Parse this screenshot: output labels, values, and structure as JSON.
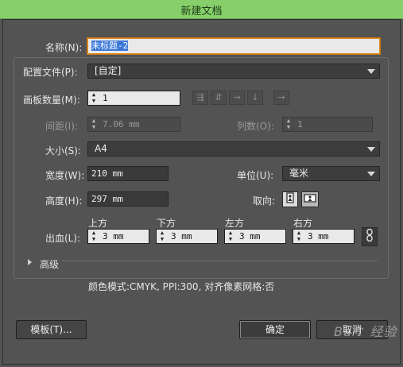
{
  "window": {
    "title": "新建文档"
  },
  "name": {
    "label": "名称(N):",
    "value": "未标题-2"
  },
  "profile": {
    "label": "配置文件(P):",
    "value": "[自定]"
  },
  "artboards": {
    "label": "画板数量(M):",
    "value": "1",
    "spacing_label": "间距(I):",
    "spacing_value": "7.06 mm",
    "columns_label": "列数(O):",
    "columns_value": "1",
    "layout_icons": [
      "grid-by-row-icon",
      "grid-by-column-icon",
      "arrange-by-row-icon",
      "arrange-by-column-icon",
      "right-to-left-icon"
    ]
  },
  "size": {
    "label": "大小(S):",
    "value": "A4"
  },
  "width": {
    "label": "宽度(W):",
    "value": "210 mm"
  },
  "height": {
    "label": "高度(H):",
    "value": "297 mm"
  },
  "units": {
    "label": "单位(U):",
    "value": "毫米"
  },
  "orientation": {
    "label": "取向:",
    "icons": [
      "portrait-icon",
      "landscape-icon"
    ]
  },
  "bleed": {
    "label": "出血(L):",
    "top_label": "上方",
    "top_value": "3 mm",
    "bottom_label": "下方",
    "bottom_value": "3 mm",
    "left_label": "左方",
    "left_value": "3 mm",
    "right_label": "右方",
    "right_value": "3 mm",
    "link_icon": "chain-link-icon"
  },
  "advanced": {
    "label": "高级"
  },
  "summary": {
    "text": "颜色模式:CMYK, PPI:300, 对齐像素网格:否"
  },
  "buttons": {
    "templates": "模板(T)...",
    "ok": "确定",
    "cancel": "取消"
  },
  "watermark": {
    "text": "Bai♪ 经验"
  }
}
